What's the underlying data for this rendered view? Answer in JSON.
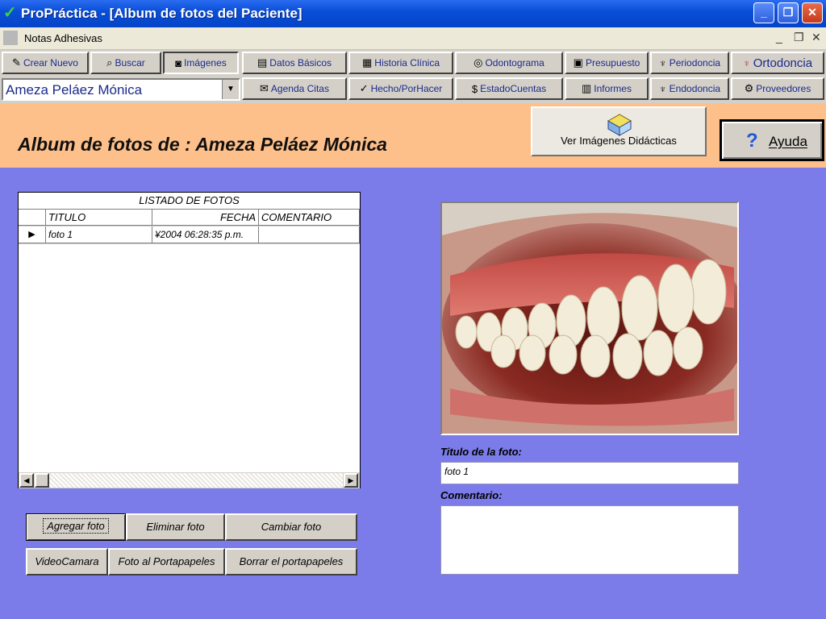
{
  "window": {
    "title": "ProPráctica - [Album de fotos del Paciente]"
  },
  "menu": {
    "notes_label": "Notas Adhesivas"
  },
  "toolbar": {
    "row1": [
      {
        "label": "Crear Nuevo"
      },
      {
        "label": "Buscar"
      },
      {
        "label": "Imágenes"
      },
      {
        "label": "Datos Básicos"
      },
      {
        "label": "Historia Clínica"
      },
      {
        "label": "Odontograma"
      },
      {
        "label": "Presupuesto"
      },
      {
        "label": "Periodoncia"
      },
      {
        "label": "Ortodoncia"
      }
    ],
    "row2": [
      {
        "label": "Agenda Citas"
      },
      {
        "label": "Hecho/PorHacer"
      },
      {
        "label": "EstadoCuentas"
      },
      {
        "label": "Informes"
      },
      {
        "label": "Endodoncia"
      },
      {
        "label": "Proveedores"
      }
    ]
  },
  "patient_select": {
    "value": "Ameza Peláez Mónica"
  },
  "header": {
    "title": "Album de fotos de : Ameza Peláez Mónica",
    "ver_imagenes_label": "Ver Imágenes Didácticas",
    "help_label": "Ayuda"
  },
  "photo_list": {
    "caption": "LISTADO DE FOTOS",
    "columns": [
      "TITULO",
      "FECHA",
      "COMENTARIO"
    ],
    "rows": [
      {
        "titulo": "foto 1",
        "fecha": "¥2004 06:28:35 p.m.",
        "comentario": ""
      }
    ]
  },
  "photo_panel": {
    "title_label": "Titulo de la foto:",
    "title_value": "foto 1",
    "comment_label": "Comentario:",
    "comment_value": ""
  },
  "buttons": {
    "agregar": "Agregar foto",
    "eliminar": "Eliminar foto",
    "cambiar": "Cambiar foto",
    "videocamara": "VideoCamara",
    "portapapeles": "Foto al Portapapeles",
    "borrar_portapapeles": "Borrar el portapapeles"
  },
  "colors": {
    "background": "#7b7bea",
    "header": "#fec08a",
    "titlebar": "#0a4fd8"
  }
}
